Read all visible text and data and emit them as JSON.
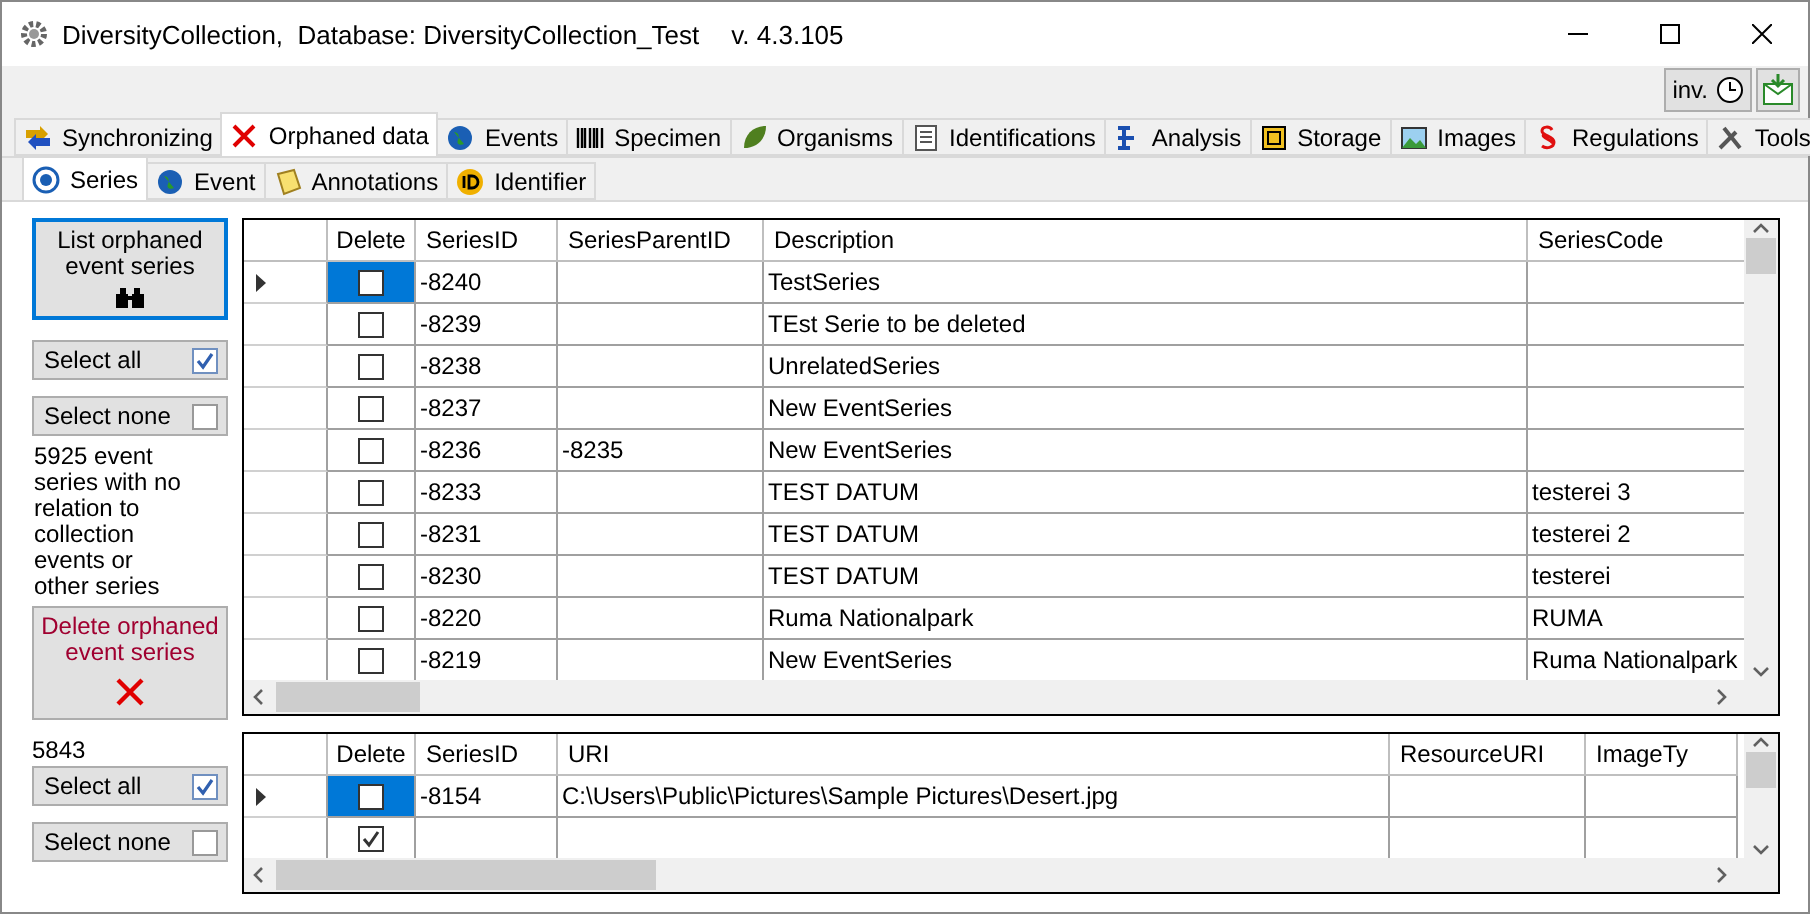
{
  "window": {
    "title": "DiversityCollection,  Database: DiversityCollection_Test",
    "version": "v. 4.3.105"
  },
  "toolbar": {
    "button": "inv."
  },
  "tabs": [
    {
      "label": "Synchronizing",
      "selected": false
    },
    {
      "label": "Orphaned data",
      "selected": true
    },
    {
      "label": "Events",
      "selected": false
    },
    {
      "label": "Specimen",
      "selected": false
    },
    {
      "label": "Organisms",
      "selected": false
    },
    {
      "label": "Identifications",
      "selected": false
    },
    {
      "label": "Analysis",
      "selected": false
    },
    {
      "label": "Storage",
      "selected": false
    },
    {
      "label": "Images",
      "selected": false
    },
    {
      "label": "Regulations",
      "selected": false
    },
    {
      "label": "Tools",
      "selected": false
    }
  ],
  "subtabs": [
    {
      "label": "Series",
      "selected": true
    },
    {
      "label": "Event",
      "selected": false
    },
    {
      "label": "Annotations",
      "selected": false
    },
    {
      "label": "Identifier",
      "selected": false
    }
  ],
  "left_panel": {
    "list_button": "List orphaned event series",
    "select_all": {
      "label": "Select all",
      "checked": true
    },
    "select_none": {
      "label": "Select none",
      "checked": false
    },
    "info": "5925 event series with no relation to collection events or other series",
    "delete_button": "Delete orphaned event series",
    "count": "5843",
    "select_all_2": {
      "label": "Select all",
      "checked": true
    },
    "select_none_2": {
      "label": "Select none",
      "checked": false
    }
  },
  "series_table": {
    "delete_column": "Delete",
    "columns": [
      "SeriesID",
      "SeriesParentID",
      "Description",
      "SeriesCode"
    ],
    "rows": [
      {
        "selected": true,
        "checked": false,
        "cells": [
          "-8240",
          "",
          "TestSeries",
          ""
        ]
      },
      {
        "selected": false,
        "checked": false,
        "cells": [
          "-8239",
          "",
          "TEst Serie to be deleted",
          ""
        ]
      },
      {
        "selected": false,
        "checked": false,
        "cells": [
          "-8238",
          "",
          "UnrelatedSeries",
          ""
        ]
      },
      {
        "selected": false,
        "checked": false,
        "cells": [
          "-8237",
          "",
          "New EventSeries",
          ""
        ]
      },
      {
        "selected": false,
        "checked": false,
        "cells": [
          "-8236",
          "-8235",
          "New EventSeries",
          ""
        ]
      },
      {
        "selected": false,
        "checked": false,
        "cells": [
          "-8233",
          "",
          "TEST DATUM",
          "testerei 3"
        ]
      },
      {
        "selected": false,
        "checked": false,
        "cells": [
          "-8231",
          "",
          "TEST DATUM",
          "testerei 2"
        ]
      },
      {
        "selected": false,
        "checked": false,
        "cells": [
          "-8230",
          "",
          "TEST DATUM",
          "testerei"
        ]
      },
      {
        "selected": false,
        "checked": false,
        "cells": [
          "-8220",
          "",
          "Ruma Nationalpark",
          "RUMA"
        ]
      },
      {
        "selected": false,
        "checked": false,
        "cells": [
          "-8219",
          "",
          "New EventSeries",
          "Ruma Nationalpark"
        ]
      }
    ]
  },
  "image_table": {
    "delete_column": "Delete",
    "columns": [
      "SeriesID",
      "URI",
      "ResourceURI",
      "ImageTy"
    ],
    "rows": [
      {
        "selected": true,
        "checked": false,
        "cells": [
          "-8154",
          "C:\\Users\\Public\\Pictures\\Sample Pictures\\Desert.jpg",
          "",
          ""
        ]
      },
      {
        "selected": false,
        "checked": true,
        "cells": [
          "",
          "",
          "",
          ""
        ]
      }
    ]
  }
}
